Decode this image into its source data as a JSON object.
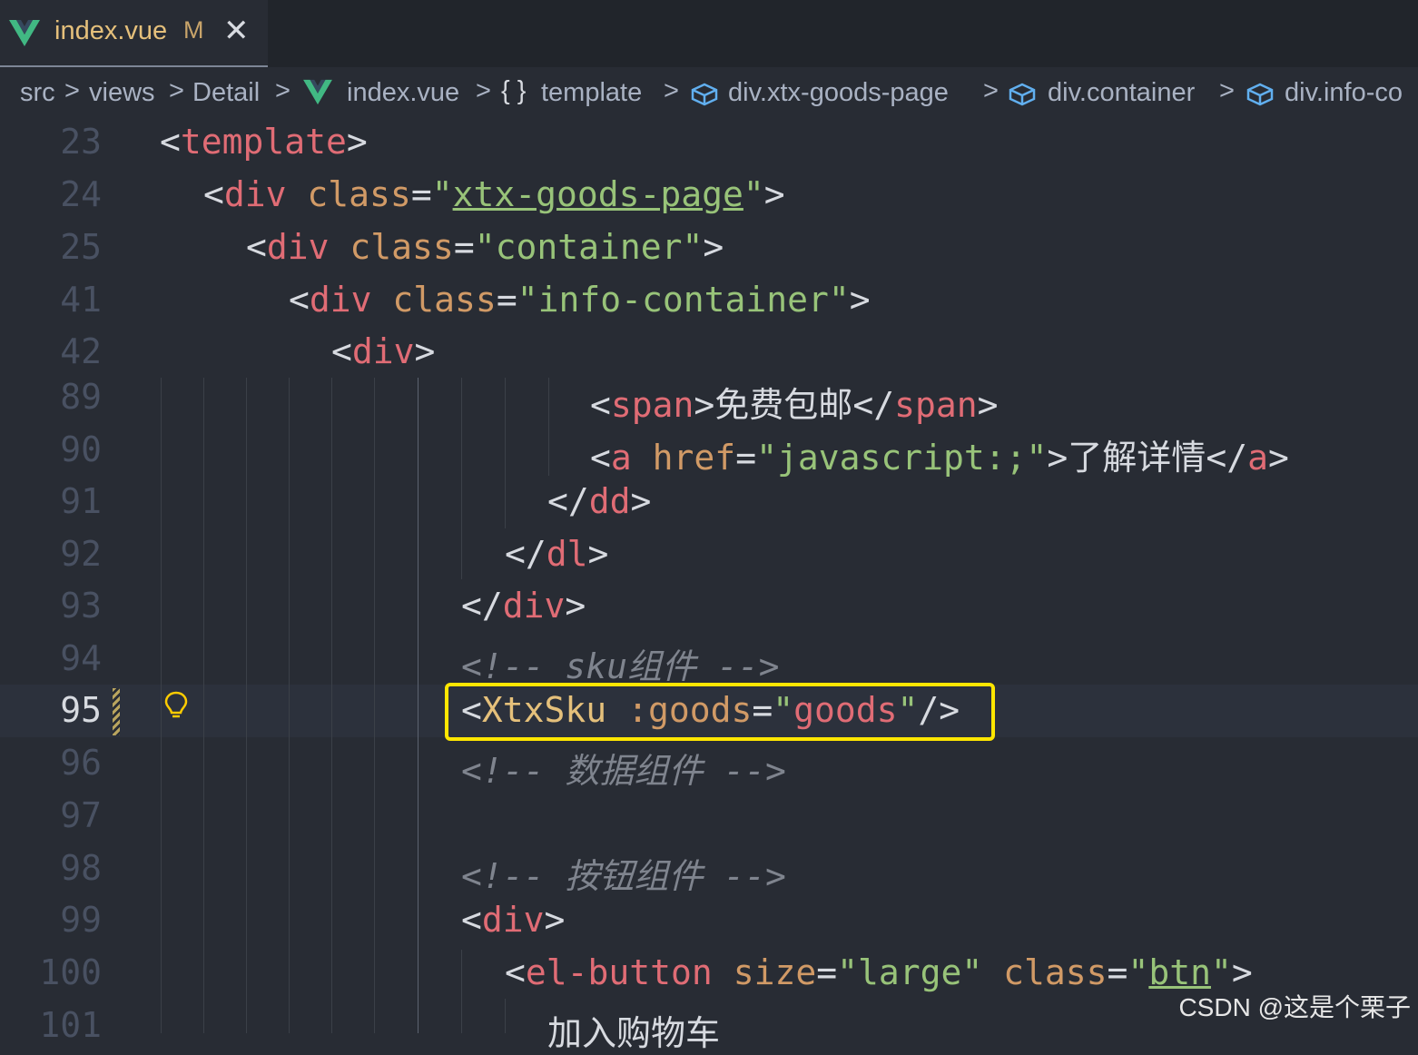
{
  "tab": {
    "filename": "index.vue",
    "status": "M",
    "close": "✕",
    "icon": "vue-icon"
  },
  "breadcrumbs": {
    "items": [
      "src",
      "views",
      "Detail",
      "index.vue",
      "template",
      "div.xtx-goods-page",
      "div.container",
      "div.info-co"
    ],
    "separator": ">",
    "braces": "{ }"
  },
  "editor": {
    "active_line": "95",
    "lines": [
      {
        "num": "23"
      },
      {
        "num": "24"
      },
      {
        "num": "25"
      },
      {
        "num": "41"
      },
      {
        "num": "42"
      },
      {
        "num": "89"
      },
      {
        "num": "90"
      },
      {
        "num": "91"
      },
      {
        "num": "92"
      },
      {
        "num": "93"
      },
      {
        "num": "94"
      },
      {
        "num": "95"
      },
      {
        "num": "96"
      },
      {
        "num": "97"
      },
      {
        "num": "98"
      },
      {
        "num": "99"
      },
      {
        "num": "100"
      },
      {
        "num": "101"
      }
    ],
    "code": {
      "l23_tag": "template",
      "l24_tag": "div",
      "l24_attr": "class",
      "l24_val": "xtx-goods-page",
      "l25_tag": "div",
      "l25_attr": "class",
      "l25_val": "container",
      "l41_tag": "div",
      "l41_attr": "class",
      "l41_val": "info-container",
      "l42_tag": "div",
      "l89_tag": "span",
      "l89_text": "免费包邮",
      "l90_tag": "a",
      "l90_attr": "href",
      "l90_val": "javascript:;",
      "l90_text": "了解详情",
      "l91_tag": "dd",
      "l92_tag": "dl",
      "l93_tag": "div",
      "l94_comment": "<!-- sku组件 -->",
      "l95_comp": "XtxSku",
      "l95_attr": ":goods",
      "l95_val": "goods",
      "l96_comment": "<!-- 数据组件 -->",
      "l98_comment": "<!-- 按钮组件 -->",
      "l99_tag": "div",
      "l100_tag": "el-button",
      "l100_attr1": "size",
      "l100_val1": "large",
      "l100_attr2": "class",
      "l100_val2": "btn",
      "l101_text": "加入购物车"
    }
  },
  "watermark": "CSDN @这是个栗子",
  "colors": {
    "highlight": "#ffe600",
    "tag": "#e06c75",
    "attr": "#d19a66",
    "string": "#98c379",
    "component": "#e5c07b"
  }
}
